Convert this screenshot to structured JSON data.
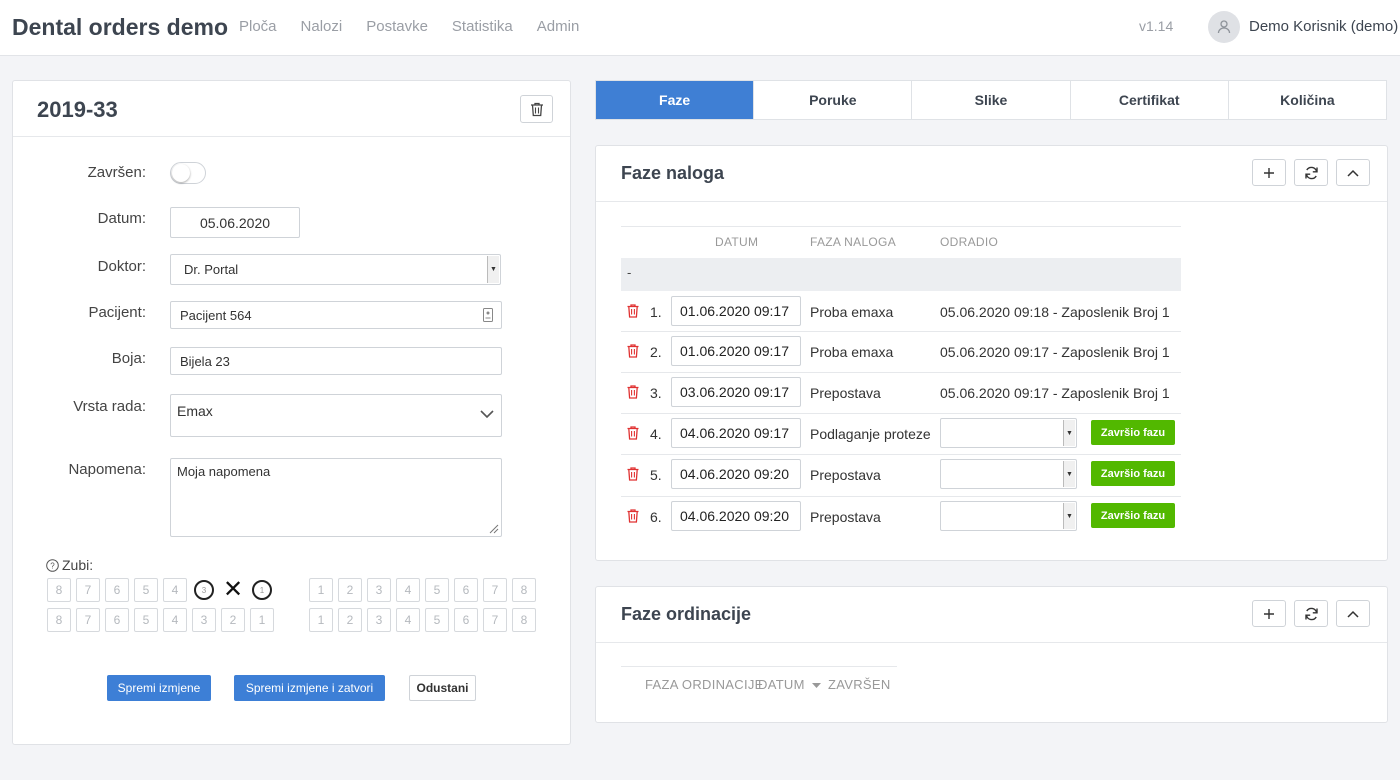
{
  "app": {
    "title": "Dental orders demo",
    "version": "v1.14",
    "user": "Demo Korisnik (demo)"
  },
  "nav": [
    "Ploča",
    "Nalozi",
    "Postavke",
    "Statistika",
    "Admin"
  ],
  "order": {
    "title": "2019-33",
    "labels": {
      "zavrsen": "Završen:",
      "datum": "Datum:",
      "doktor": "Doktor:",
      "pacijent": "Pacijent:",
      "boja": "Boja:",
      "vrsta": "Vrsta rada:",
      "napomena": "Napomena:",
      "zubi": "Zubi:"
    },
    "values": {
      "zavrsen": false,
      "datum": "05.06.2020",
      "doktor": "Dr. Portal",
      "pacijent": "Pacijent 564",
      "boja": "Bijela 23",
      "vrsta": "Emax",
      "napomena": "Moja napomena"
    },
    "teeth_upper_left": [
      "8",
      "7",
      "6",
      "5",
      "4",
      "3",
      "2",
      "1"
    ],
    "teeth_upper_right": [
      "1",
      "2",
      "3",
      "4",
      "5",
      "6",
      "7",
      "8"
    ],
    "teeth_lower_left": [
      "8",
      "7",
      "6",
      "5",
      "4",
      "3",
      "2",
      "1"
    ],
    "teeth_lower_right": [
      "1",
      "2",
      "3",
      "4",
      "5",
      "6",
      "7",
      "8"
    ],
    "teeth_marked_upper_left": {
      "3": "circle",
      "2": "x",
      "1": "circle"
    },
    "buttons": {
      "save": "Spremi izmjene",
      "save_close": "Spremi izmjene i zatvori",
      "cancel": "Odustani"
    }
  },
  "tabs": [
    "Faze",
    "Poruke",
    "Slike",
    "Certifikat",
    "Količina"
  ],
  "faze_naloga": {
    "title": "Faze naloga",
    "headers": {
      "datum": "DATUM",
      "faza": "FAZA NALOGA",
      "odradio": "ODRADIO"
    },
    "group": "-",
    "rows": [
      {
        "n": "1.",
        "datum": "01.06.2020 09:17",
        "faza": "Proba emaxa",
        "odradio": "05.06.2020 09:18 - Zaposlenik Broj 1"
      },
      {
        "n": "2.",
        "datum": "01.06.2020 09:17",
        "faza": "Proba emaxa",
        "odradio": "05.06.2020 09:17 - Zaposlenik Broj 1"
      },
      {
        "n": "3.",
        "datum": "03.06.2020 09:17",
        "faza": "Prepostava",
        "odradio": "05.06.2020 09:17 - Zaposlenik Broj 1"
      },
      {
        "n": "4.",
        "datum": "04.06.2020 09:17",
        "faza": "Podlaganje proteze",
        "odradio": ""
      },
      {
        "n": "5.",
        "datum": "04.06.2020 09:20",
        "faza": "Prepostava",
        "odradio": ""
      },
      {
        "n": "6.",
        "datum": "04.06.2020 09:20",
        "faza": "Prepostava",
        "odradio": ""
      }
    ],
    "finish_label": "Završio fazu"
  },
  "faze_ordinacije": {
    "title": "Faze ordinacije",
    "headers": {
      "faza": "FAZA ORDINACIJE",
      "datum": "DATUM",
      "zavrsen": "ZAVRŠEN"
    }
  },
  "colors": {
    "accent": "#3f7fd4",
    "success": "#52b800",
    "danger": "#e03131"
  }
}
